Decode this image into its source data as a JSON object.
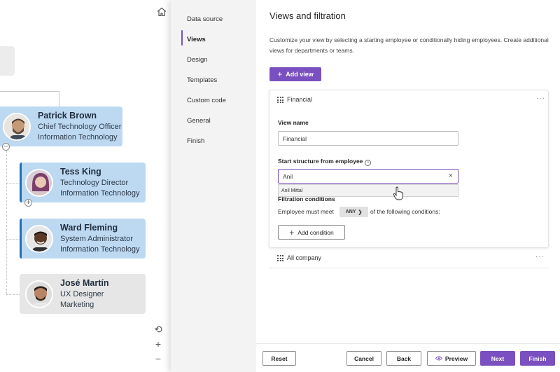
{
  "org_chart": {
    "cards": [
      {
        "name": "Patrick Brown",
        "title": "Chief Technology Officer",
        "department": "Information Technology"
      },
      {
        "name": "Tess King",
        "title": "Technology Director",
        "department": "Information Technology"
      },
      {
        "name": "Ward Fleming",
        "title": "System Administrator",
        "department": "Information Technology"
      },
      {
        "name": "José Martín",
        "title": "UX Designer",
        "department": "Marketing"
      }
    ],
    "collapse_symbol": "−",
    "expand_symbol": "+",
    "zoom": {
      "reset_icon": "⟲",
      "in_icon": "+",
      "out_icon": "−"
    }
  },
  "nav": {
    "items": [
      {
        "label": "Data source"
      },
      {
        "label": "Views"
      },
      {
        "label": "Design"
      },
      {
        "label": "Templates"
      },
      {
        "label": "Custom code"
      },
      {
        "label": "General"
      },
      {
        "label": "Finish"
      }
    ],
    "active": "Views"
  },
  "panel": {
    "title": "Views and filtration",
    "description": "Customize your view by selecting a starting employee or conditionally hiding employees. Create additional views for departments or teams.",
    "add_view_label": "Add view",
    "views": [
      {
        "label": "Financial",
        "more_icon": "···",
        "view_name_label": "View name",
        "view_name_value": "Financial",
        "start_label": "Start structure from employee",
        "start_value": "Anil",
        "clear_icon": "×",
        "suggestion": "Anil Mittal",
        "filtration_label": "Filtration conditions",
        "cond_prefix": "Employee must meet",
        "cond_select": "ANY",
        "cond_suffix": "of the following conditions:",
        "add_condition_label": "Add condition"
      },
      {
        "label": "All company",
        "more_icon": "···"
      }
    ]
  },
  "footer": {
    "reset": "Reset",
    "cancel": "Cancel",
    "back": "Back",
    "preview": "Preview",
    "next": "Next",
    "finish": "Finish"
  },
  "colors": {
    "accent": "#7a4fbf",
    "card_blue": "#bdd9f2",
    "card_gray": "#e6e6e6"
  }
}
